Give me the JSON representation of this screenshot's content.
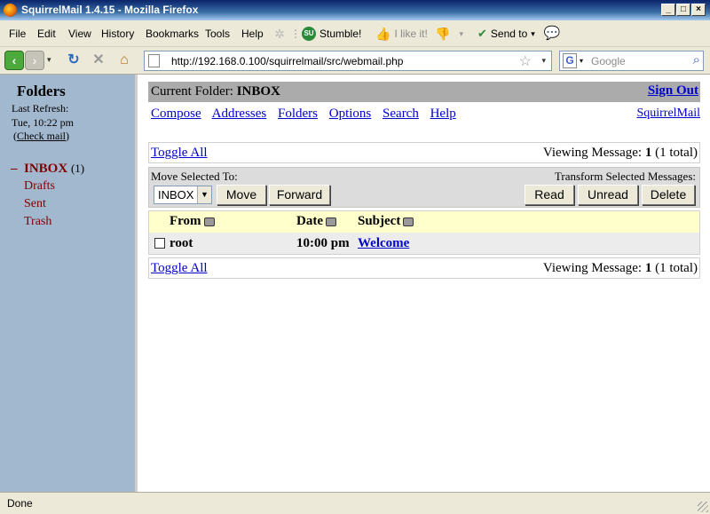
{
  "window": {
    "title": "SquirrelMail 1.4.15 - Mozilla Firefox"
  },
  "menu": {
    "items": [
      "File",
      "Edit",
      "View",
      "History",
      "Bookmarks",
      "Tools",
      "Help"
    ],
    "stumble": "Stumble!",
    "ilike": "I like it!",
    "sendto": "Send to"
  },
  "nav": {
    "url": "http://192.168.0.100/squirrelmail/src/webmail.php",
    "search_placeholder": "Google"
  },
  "sidebar": {
    "title": "Folders",
    "last_refresh_label": "Last Refresh:",
    "last_refresh_time": "Tue, 10:22 pm",
    "check_mail": "Check mail",
    "inbox_toggle": "–",
    "inbox": "INBOX",
    "inbox_count": "(1)",
    "folders": [
      "Drafts",
      "Sent",
      "Trash"
    ]
  },
  "main": {
    "current_folder_label": "Current Folder:",
    "current_folder": "INBOX",
    "sign_out": "Sign Out",
    "links": [
      "Compose",
      "Addresses",
      "Folders",
      "Options",
      "Search",
      "Help"
    ],
    "squirrelmail_link": "SquirrelMail",
    "toggle_all": "Toggle All",
    "viewing_label": "Viewing Message:",
    "viewing_num": "1",
    "viewing_total": "(1 total)",
    "move_label": "Move Selected To:",
    "move_target": "INBOX",
    "move_btn": "Move",
    "forward_btn": "Forward",
    "transform_label": "Transform Selected Messages:",
    "read_btn": "Read",
    "unread_btn": "Unread",
    "delete_btn": "Delete",
    "columns": [
      "From",
      "Date",
      "Subject"
    ],
    "messages": [
      {
        "from": "root",
        "date": "10:00 pm",
        "subject": "Welcome",
        "selected": false
      }
    ]
  },
  "status": {
    "text": "Done"
  }
}
